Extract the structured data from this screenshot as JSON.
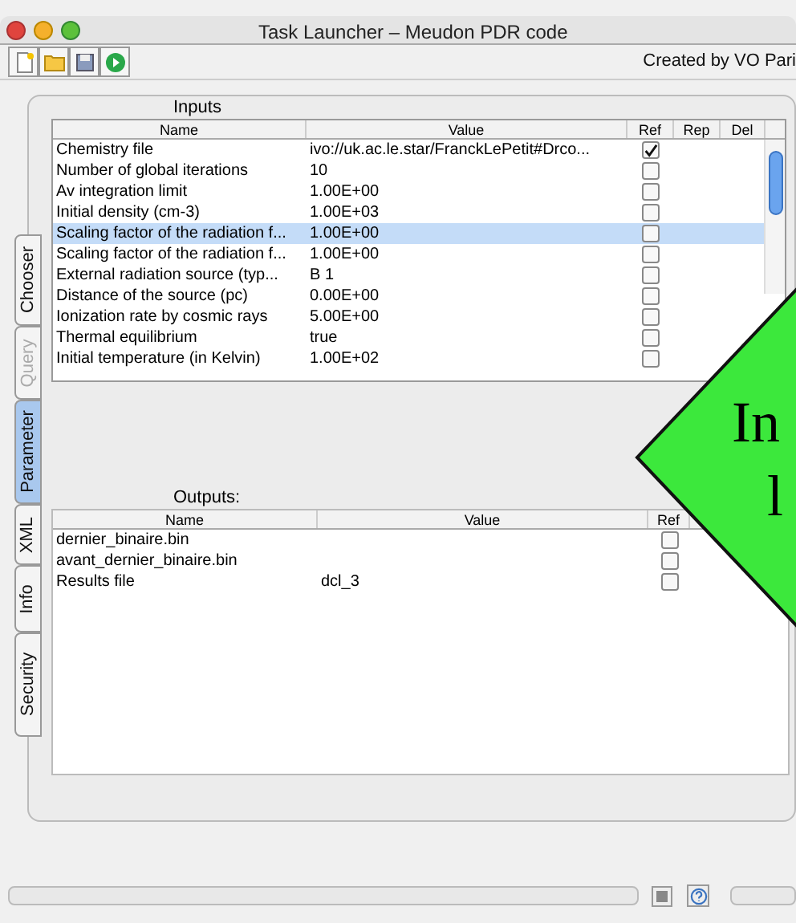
{
  "window": {
    "title": "Task Launcher – Meudon PDR code"
  },
  "toolbar": {
    "buttons": [
      {
        "kind": "new"
      },
      {
        "kind": "open"
      },
      {
        "kind": "save"
      },
      {
        "kind": "run"
      }
    ],
    "credit": "Created by VO Pari"
  },
  "side_tabs": [
    {
      "label": "Chooser",
      "selected": false,
      "disabled": false
    },
    {
      "label": "Query",
      "selected": false,
      "disabled": true
    },
    {
      "label": "Parameter",
      "selected": true,
      "disabled": false
    },
    {
      "label": "XML",
      "selected": false,
      "disabled": false
    },
    {
      "label": "Info",
      "selected": false,
      "disabled": false
    },
    {
      "label": "Security",
      "selected": false,
      "disabled": false
    }
  ],
  "inputs": {
    "title": "Inputs",
    "columns": [
      "Name",
      "Value",
      "Ref",
      "Rep",
      "Del"
    ],
    "rows": [
      {
        "name": "Chemistry file",
        "value": "ivo://uk.ac.le.star/FranckLePetit#Drco...",
        "ref": true,
        "selected": false
      },
      {
        "name": "Number of global iterations",
        "value": "10",
        "ref": false,
        "selected": false
      },
      {
        "name": "Av integration limit",
        "value": "1.00E+00",
        "ref": false,
        "selected": false
      },
      {
        "name": "Initial density (cm-3)",
        "value": "1.00E+03",
        "ref": false,
        "selected": false
      },
      {
        "name": "Scaling factor of the radiation f...",
        "value": "1.00E+00",
        "ref": false,
        "selected": true
      },
      {
        "name": "Scaling factor of the radiation f...",
        "value": "1.00E+00",
        "ref": false,
        "selected": false
      },
      {
        "name": "External radiation source (typ...",
        "value": "B 1",
        "ref": false,
        "selected": false
      },
      {
        "name": "Distance of the source (pc)",
        "value": "0.00E+00",
        "ref": false,
        "selected": false
      },
      {
        "name": "Ionization rate by cosmic rays",
        "value": "5.00E+00",
        "ref": false,
        "selected": false
      },
      {
        "name": "Thermal equilibrium",
        "value": "true",
        "ref": false,
        "selected": false
      },
      {
        "name": "Initial temperature (in Kelvin)",
        "value": "1.00E+02",
        "ref": false,
        "selected": false
      }
    ]
  },
  "outputs": {
    "title": "Outputs:",
    "columns": [
      "Name",
      "Value",
      "Ref"
    ],
    "rows": [
      {
        "name": "dernier_binaire.bin",
        "ref": false
      },
      {
        "name": "avant_dernier_binaire.bin",
        "ref": false
      },
      {
        "name": "Results file",
        "value": "dcl_3",
        "ref": false
      }
    ]
  },
  "callout": {
    "lines": [
      "In",
      "l"
    ]
  }
}
